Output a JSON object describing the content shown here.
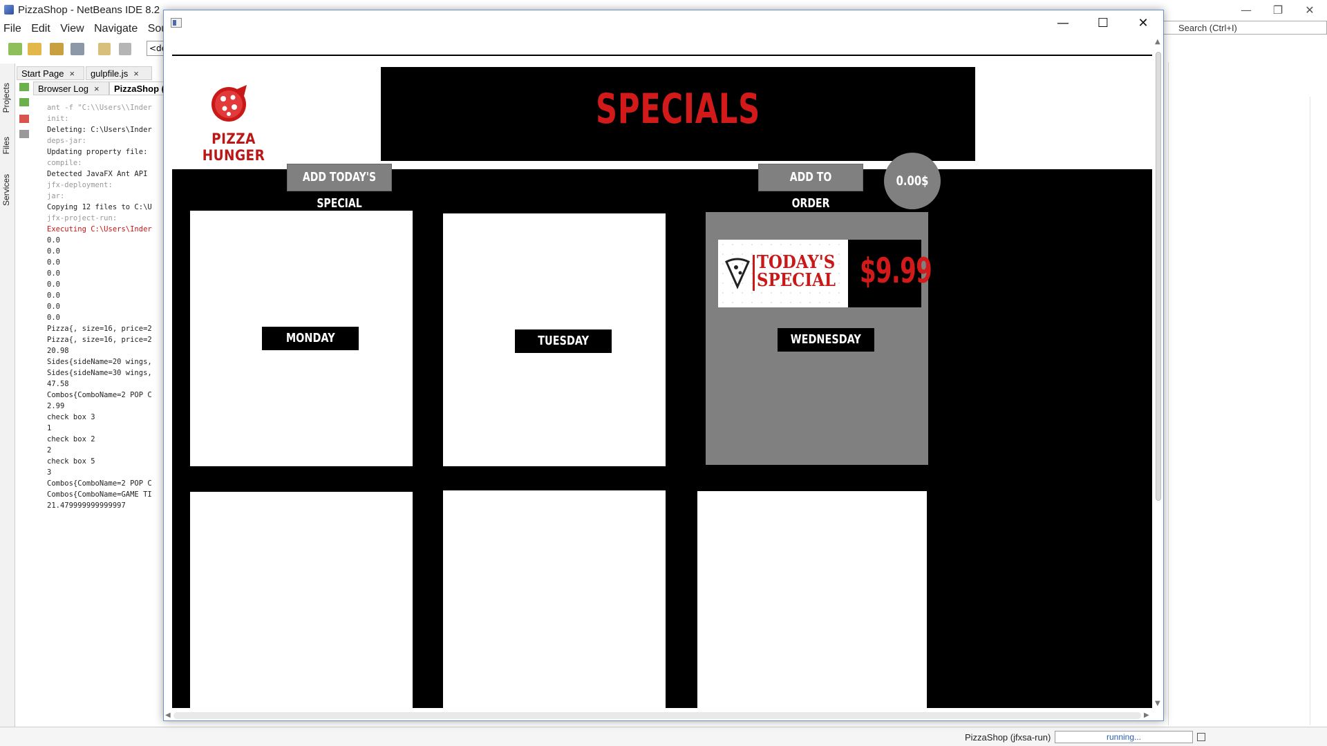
{
  "ide": {
    "title": "PizzaShop - NetBeans IDE 8.2",
    "menu": [
      "File",
      "Edit",
      "View",
      "Navigate",
      "Source"
    ],
    "config_value": "<de",
    "search_placeholder": "Search (Ctrl+I)",
    "side_tabs": [
      "Projects",
      "Files",
      "Services"
    ],
    "editor_tabs": [
      "Start Page",
      "gulpfile.js"
    ],
    "output_tabs": [
      "Browser Log",
      "PizzaShop (j"
    ],
    "output_lines": [
      {
        "text": "ant -f \"C:\\\\Users\\\\Inder",
        "style": "gray"
      },
      {
        "text": "init:",
        "style": "gray"
      },
      {
        "text": "Deleting: C:\\Users\\Inder",
        "style": "normal"
      },
      {
        "text": "deps-jar:",
        "style": "gray"
      },
      {
        "text": "Updating property file:",
        "style": "normal"
      },
      {
        "text": "compile:",
        "style": "gray"
      },
      {
        "text": "Detected JavaFX Ant API",
        "style": "normal"
      },
      {
        "text": "jfx-deployment:",
        "style": "gray"
      },
      {
        "text": "jar:",
        "style": "gray"
      },
      {
        "text": "Copying 12 files to C:\\U",
        "style": "normal"
      },
      {
        "text": "jfx-project-run:",
        "style": "gray"
      },
      {
        "text": "Executing C:\\Users\\Inder",
        "style": "red"
      },
      {
        "text": "0.0",
        "style": "normal"
      },
      {
        "text": "0.0",
        "style": "normal"
      },
      {
        "text": "0.0",
        "style": "normal"
      },
      {
        "text": "0.0",
        "style": "normal"
      },
      {
        "text": "0.0",
        "style": "normal"
      },
      {
        "text": "0.0",
        "style": "normal"
      },
      {
        "text": "0.0",
        "style": "normal"
      },
      {
        "text": "0.0",
        "style": "normal"
      },
      {
        "text": "Pizza{, size=16, price=2",
        "style": "normal"
      },
      {
        "text": "Pizza{, size=16, price=2",
        "style": "normal"
      },
      {
        "text": "20.98",
        "style": "normal"
      },
      {
        "text": "Sides{sideName=20 wings,",
        "style": "normal"
      },
      {
        "text": "Sides{sideName=30 wings,",
        "style": "normal"
      },
      {
        "text": "47.58",
        "style": "normal"
      },
      {
        "text": "Combos{ComboName=2 POP C",
        "style": "normal"
      },
      {
        "text": "2.99",
        "style": "normal"
      },
      {
        "text": "check box 3",
        "style": "normal"
      },
      {
        "text": "1",
        "style": "normal"
      },
      {
        "text": "check box 2",
        "style": "normal"
      },
      {
        "text": "2",
        "style": "normal"
      },
      {
        "text": "check box 5",
        "style": "normal"
      },
      {
        "text": "3",
        "style": "normal"
      },
      {
        "text": "Combos{ComboName=2 POP C",
        "style": "normal"
      },
      {
        "text": "Combos{ComboName=GAME TI",
        "style": "normal"
      },
      {
        "text": "21.479999999999997",
        "style": "normal"
      }
    ],
    "status_task": "PizzaShop (jfxsa-run)",
    "status_progress": "running..."
  },
  "app": {
    "window_controls": {
      "minimize": "—",
      "maximize": "☐",
      "close": "✕"
    },
    "logo_text": "PIZZA HUNGER",
    "banner_title": "SPECIALS",
    "add_special_button": "ADD TODAY'S SPECIAL",
    "add_order_button": "ADD TO ORDER",
    "order_total": "0.00$",
    "days": [
      {
        "label": "MONDAY",
        "selected": false
      },
      {
        "label": "TUESDAY",
        "selected": false
      },
      {
        "label": "WEDNESDAY",
        "selected": true
      }
    ],
    "special": {
      "line1": "TODAY'S",
      "line2": "SPECIAL",
      "price": "$9.99"
    }
  },
  "colors": {
    "brand_red": "#d21a1a",
    "button_gray": "#808080",
    "background_black": "#000000"
  }
}
